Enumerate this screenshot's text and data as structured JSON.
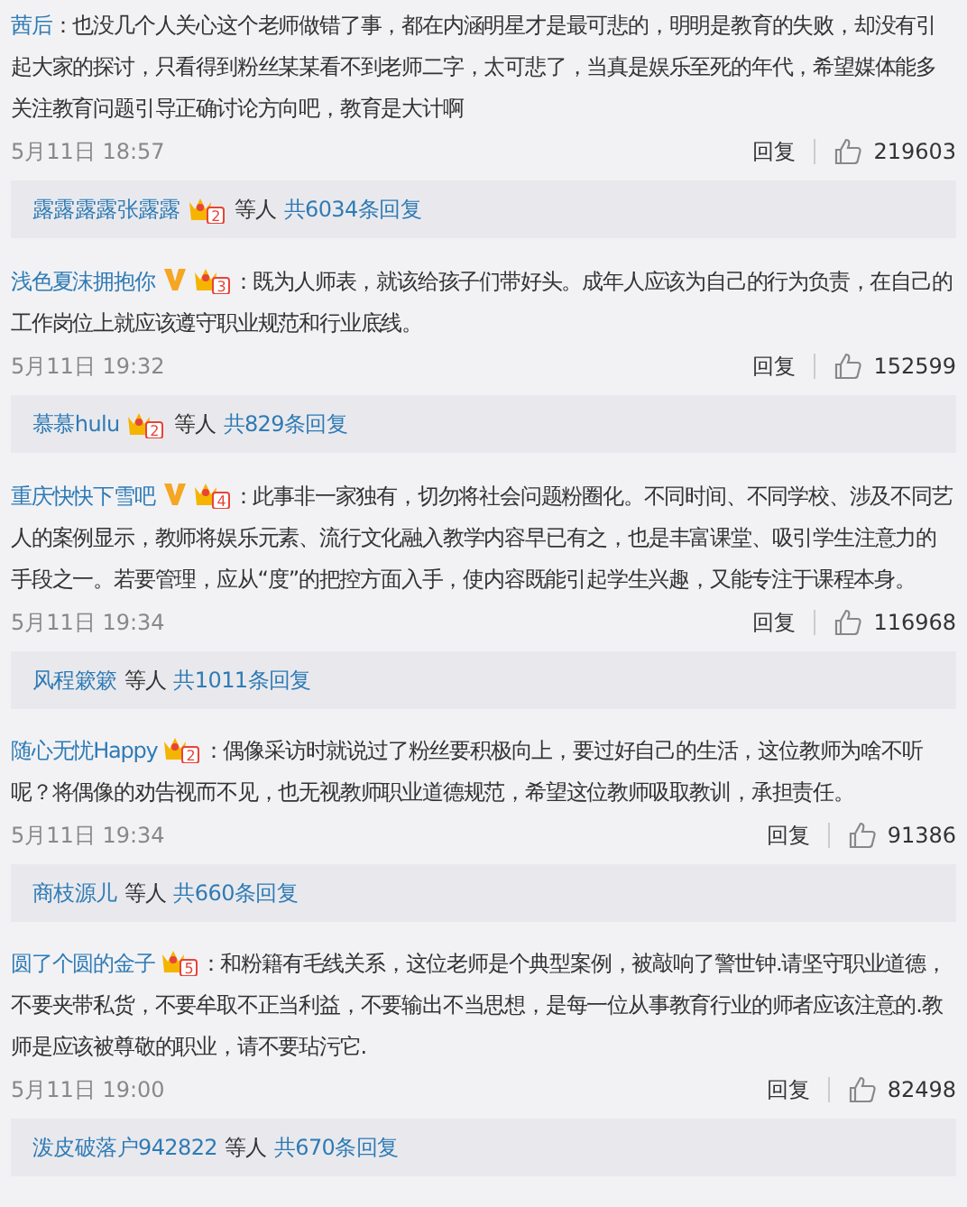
{
  "comments": [
    {
      "author": "茜后",
      "verified": false,
      "text": "：也没几个人关心这个老师做错了事，都在内涵明星才是最可悲的，明明是教育的失败，却没有引起大家的探讨，只看得到粉丝某某看不到老师二字，太可悲了，当真是娱乐至死的年代，希望媒体能多关注教育问题引导正确讨论方向吧，教育是大计啊",
      "time": "5月11日 18:57",
      "reply": "回复",
      "likes": "219603",
      "thread": {
        "names": "露露露露张露露",
        "crown_level": "2",
        "suffix": "等人",
        "count": "共6034条回复"
      }
    },
    {
      "author": "浅色夏沫拥抱你",
      "verified": true,
      "crown_level": "3",
      "text": "：既为人师表，就该给孩子们带好头。成年人应该为自己的行为负责，在自己的工作岗位上就应该遵守职业规范和行业底线。",
      "time": "5月11日 19:32",
      "reply": "回复",
      "likes": "152599",
      "thread": {
        "names": "慕慕hulu",
        "crown_level": "2",
        "suffix": "等人",
        "count": "共829条回复"
      }
    },
    {
      "author": "重庆快快下雪吧",
      "verified": true,
      "crown_level": "4",
      "text": "：此事非一家独有，切勿将社会问题粉圈化。不同时间、不同学校、涉及不同艺人的案例显示，教师将娱乐元素、流行文化融入教学内容早已有之，也是丰富课堂、吸引学生注意力的手段之一。若要管理，应从“度”的把控方面入手，使内容既能引起学生兴趣，又能专注于课程本身。",
      "time": "5月11日 19:34",
      "reply": "回复",
      "likes": "116968",
      "thread": {
        "names": "风程簌簌",
        "suffix": "等人",
        "count": "共1011条回复"
      }
    },
    {
      "author": "随心无忧Happy",
      "verified": false,
      "crown_level": "2",
      "text": "：偶像采访时就说过了粉丝要积极向上，要过好自己的生活，这位教师为啥不听呢？将偶像的劝告视而不见，也无视教师职业道德规范，希望这位教师吸取教训，承担责任。",
      "time": "5月11日 19:34",
      "reply": "回复",
      "likes": "91386",
      "thread": {
        "names": "商枝源儿",
        "suffix": "等人",
        "count": "共660条回复"
      }
    },
    {
      "author": "圆了个圆的金子",
      "verified": false,
      "crown_level": "5",
      "text": "：和粉籍有毛线关系，这位老师是个典型案例，被敲响了警世钟.请坚守职业道德，不要夹带私货，不要牟取不正当利益，不要输出不当思想，是每一位从事教育行业的师者应该注意的.教师是应该被尊敬的职业，请不要玷污它.",
      "time": "5月11日 19:00",
      "reply": "回复",
      "likes": "82498",
      "thread": {
        "names": "泼皮破落户942822",
        "suffix": "等人",
        "count": "共670条回复"
      }
    }
  ]
}
